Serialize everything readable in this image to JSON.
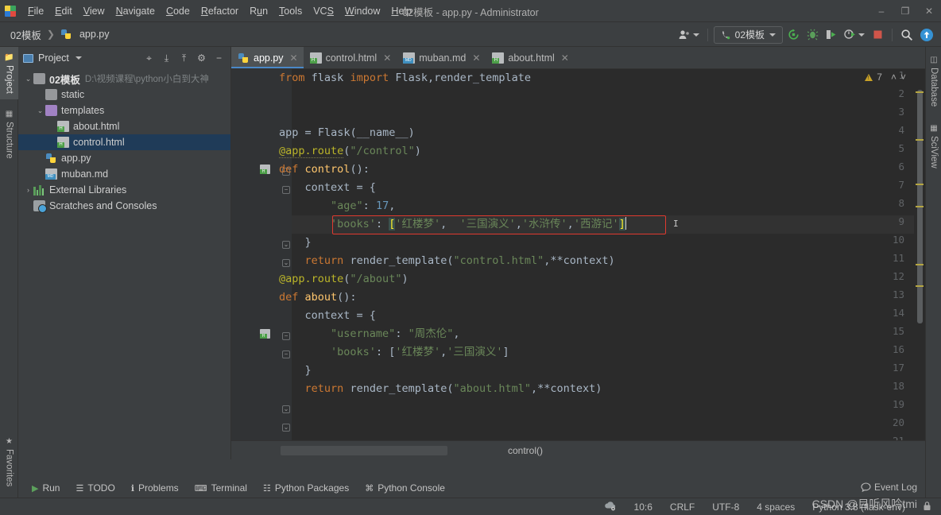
{
  "window": {
    "title": "02模板 - app.py - Administrator",
    "logo_icon": "pycharm-logo-icon",
    "controls": [
      {
        "name": "minimize-button",
        "glyph": "‒"
      },
      {
        "name": "maximize-button",
        "glyph": "❐"
      },
      {
        "name": "close-button",
        "glyph": "✕"
      }
    ]
  },
  "menubar": [
    {
      "label": "File",
      "mnemonic": "F"
    },
    {
      "label": "Edit",
      "mnemonic": "E"
    },
    {
      "label": "View",
      "mnemonic": "V"
    },
    {
      "label": "Navigate",
      "mnemonic": "N"
    },
    {
      "label": "Code",
      "mnemonic": "C"
    },
    {
      "label": "Refactor",
      "mnemonic": "R"
    },
    {
      "label": "Run",
      "mnemonic": "u"
    },
    {
      "label": "Tools",
      "mnemonic": "T"
    },
    {
      "label": "VCS",
      "mnemonic": "S"
    },
    {
      "label": "Window",
      "mnemonic": "W"
    },
    {
      "label": "Help",
      "mnemonic": "H"
    }
  ],
  "navbar": {
    "breadcrumbs": [
      {
        "label": "02模板",
        "icon": "project-icon"
      },
      {
        "label": "app.py",
        "icon": "python-file-icon"
      }
    ],
    "separator": "❯",
    "right_controls": [
      {
        "name": "user-account-icon",
        "label": ""
      },
      {
        "name": "run-configuration-selector",
        "label": "02模板"
      },
      {
        "name": "rerun-icon",
        "label": ""
      },
      {
        "name": "debug-icon",
        "label": ""
      },
      {
        "name": "run-with-coverage-icon",
        "label": ""
      },
      {
        "name": "profile-icon",
        "label": ""
      },
      {
        "name": "stop-icon",
        "label": ""
      },
      {
        "name": "search-everywhere-icon",
        "label": ""
      },
      {
        "name": "update-project-icon",
        "label": ""
      }
    ]
  },
  "left_rail": {
    "tabs": [
      {
        "label": "Project",
        "icon": "project-icon",
        "active": true
      },
      {
        "label": "Structure",
        "icon": "structure-icon",
        "active": false
      },
      {
        "label": "Favorites",
        "icon": "star-icon",
        "active": false
      }
    ]
  },
  "right_rail": {
    "tabs": [
      {
        "label": "Database",
        "icon": "database-icon"
      },
      {
        "label": "SciView",
        "icon": "sciview-icon"
      }
    ]
  },
  "project_panel": {
    "title": "Project",
    "dropdown_glyph": "▾",
    "tools": [
      {
        "name": "locate-file-icon",
        "glyph": "⌖"
      },
      {
        "name": "expand-all-icon",
        "glyph": "⤓"
      },
      {
        "name": "collapse-all-icon",
        "glyph": "⤒"
      },
      {
        "name": "settings-gear-icon",
        "glyph": "⚙"
      },
      {
        "name": "hide-panel-icon",
        "glyph": "−"
      }
    ],
    "tree": [
      {
        "label": "02模板",
        "path": "D:\\视频课程\\python小白到大神",
        "icon": "folder-icon",
        "arrow": "⌄",
        "depth": 0,
        "bold": true,
        "selected": false
      },
      {
        "label": "static",
        "path": "",
        "icon": "folder-icon",
        "arrow": "",
        "depth": 1,
        "bold": false,
        "selected": false
      },
      {
        "label": "templates",
        "path": "",
        "icon": "folder-purple-icon",
        "arrow": "⌄",
        "depth": 1,
        "bold": false,
        "selected": false
      },
      {
        "label": "about.html",
        "path": "",
        "icon": "html-file-icon",
        "arrow": "",
        "depth": 2,
        "bold": false,
        "selected": false
      },
      {
        "label": "control.html",
        "path": "",
        "icon": "html-file-icon",
        "arrow": "",
        "depth": 2,
        "bold": false,
        "selected": true
      },
      {
        "label": "app.py",
        "path": "",
        "icon": "python-file-icon",
        "arrow": "",
        "depth": 1,
        "bold": false,
        "selected": false
      },
      {
        "label": "muban.md",
        "path": "",
        "icon": "markdown-file-icon",
        "arrow": "",
        "depth": 1,
        "bold": false,
        "selected": false
      },
      {
        "label": "External Libraries",
        "path": "",
        "icon": "library-icon",
        "arrow": "›",
        "depth": 0,
        "bold": false,
        "selected": false
      },
      {
        "label": "Scratches and Consoles",
        "path": "",
        "icon": "scratches-icon",
        "arrow": "",
        "depth": 0,
        "bold": false,
        "selected": false
      }
    ]
  },
  "editor": {
    "tabs": [
      {
        "label": "app.py",
        "icon": "python-file-icon",
        "active": true,
        "close_glyph": "✕"
      },
      {
        "label": "control.html",
        "icon": "html-file-icon",
        "active": false,
        "close_glyph": "✕"
      },
      {
        "label": "muban.md",
        "icon": "markdown-file-icon",
        "active": false,
        "close_glyph": "✕"
      },
      {
        "label": "about.html",
        "icon": "html-file-icon",
        "active": false,
        "close_glyph": "✕"
      }
    ],
    "inspection": {
      "warning_count": "7",
      "warning_icon": "warning-triangle-icon",
      "prev_glyph": "˄",
      "next_glyph": "˅"
    },
    "breadcrumb": "control()",
    "language": "python",
    "highlight_box_line": 9,
    "current_line": 9,
    "lines": [
      {
        "n": "1",
        "text": "from flask import Flask,render_template"
      },
      {
        "n": "2",
        "text": ""
      },
      {
        "n": "3",
        "text": "app = Flask(__name__)"
      },
      {
        "n": "4",
        "text": ""
      },
      {
        "n": "5",
        "text": "@app.route(\"/control\")"
      },
      {
        "n": "6",
        "text": "def control():"
      },
      {
        "n": "7",
        "text": "    context = {"
      },
      {
        "n": "8",
        "text": "        \"age\": 17,"
      },
      {
        "n": "9",
        "text": "        'books': ['红楼梦', '三国演义','水浒传','西游记']"
      },
      {
        "n": "10",
        "text": "    }"
      },
      {
        "n": "11",
        "text": "    return render_template(\"control.html\",**context)"
      },
      {
        "n": "12",
        "text": ""
      },
      {
        "n": "13",
        "text": ""
      },
      {
        "n": "14",
        "text": "@app.route(\"/about\")"
      },
      {
        "n": "15",
        "text": "def about():"
      },
      {
        "n": "16",
        "text": "    context = {"
      },
      {
        "n": "17",
        "text": "        \"username\": \"周杰伦\","
      },
      {
        "n": "18",
        "text": "        'books': ['红楼梦','三国演义']"
      },
      {
        "n": "19",
        "text": "    }"
      },
      {
        "n": "20",
        "text": "    return render_template(\"about.html\",**context)"
      },
      {
        "n": "21",
        "text": ""
      }
    ]
  },
  "toolwindow_bar": [
    {
      "label": "Run",
      "icon": "run-icon"
    },
    {
      "label": "TODO",
      "icon": "todo-icon"
    },
    {
      "label": "Problems",
      "icon": "problems-icon"
    },
    {
      "label": "Terminal",
      "icon": "terminal-icon"
    },
    {
      "label": "Python Packages",
      "icon": "packages-icon"
    },
    {
      "label": "Python Console",
      "icon": "python-console-icon"
    }
  ],
  "statusbar": {
    "event_log": "Event Log",
    "event_log_icon": "balloon-icon",
    "sync_icon": "cloud-sync-icon",
    "caret_position": "10:6",
    "line_separator": "CRLF",
    "encoding": "UTF-8",
    "indent": "4 spaces",
    "interpreter": "Python 3.8 (flask-env)",
    "lock_icon": "lock-icon"
  },
  "watermark": "CSDN @目听风吟tmi",
  "colors": {
    "panel_bg": "#3c3f41",
    "editor_bg": "#2b2b2b",
    "gutter_bg": "#313335",
    "selection_blue": "#1f3b58",
    "accent_blue": "#4a88c7",
    "keyword_orange": "#cc7832",
    "string_green": "#6a8759",
    "number_blue": "#6897bb",
    "decorator_yellow": "#bbb529",
    "function_yellow": "#ffc66d",
    "annotation_red": "#e03a2f"
  }
}
